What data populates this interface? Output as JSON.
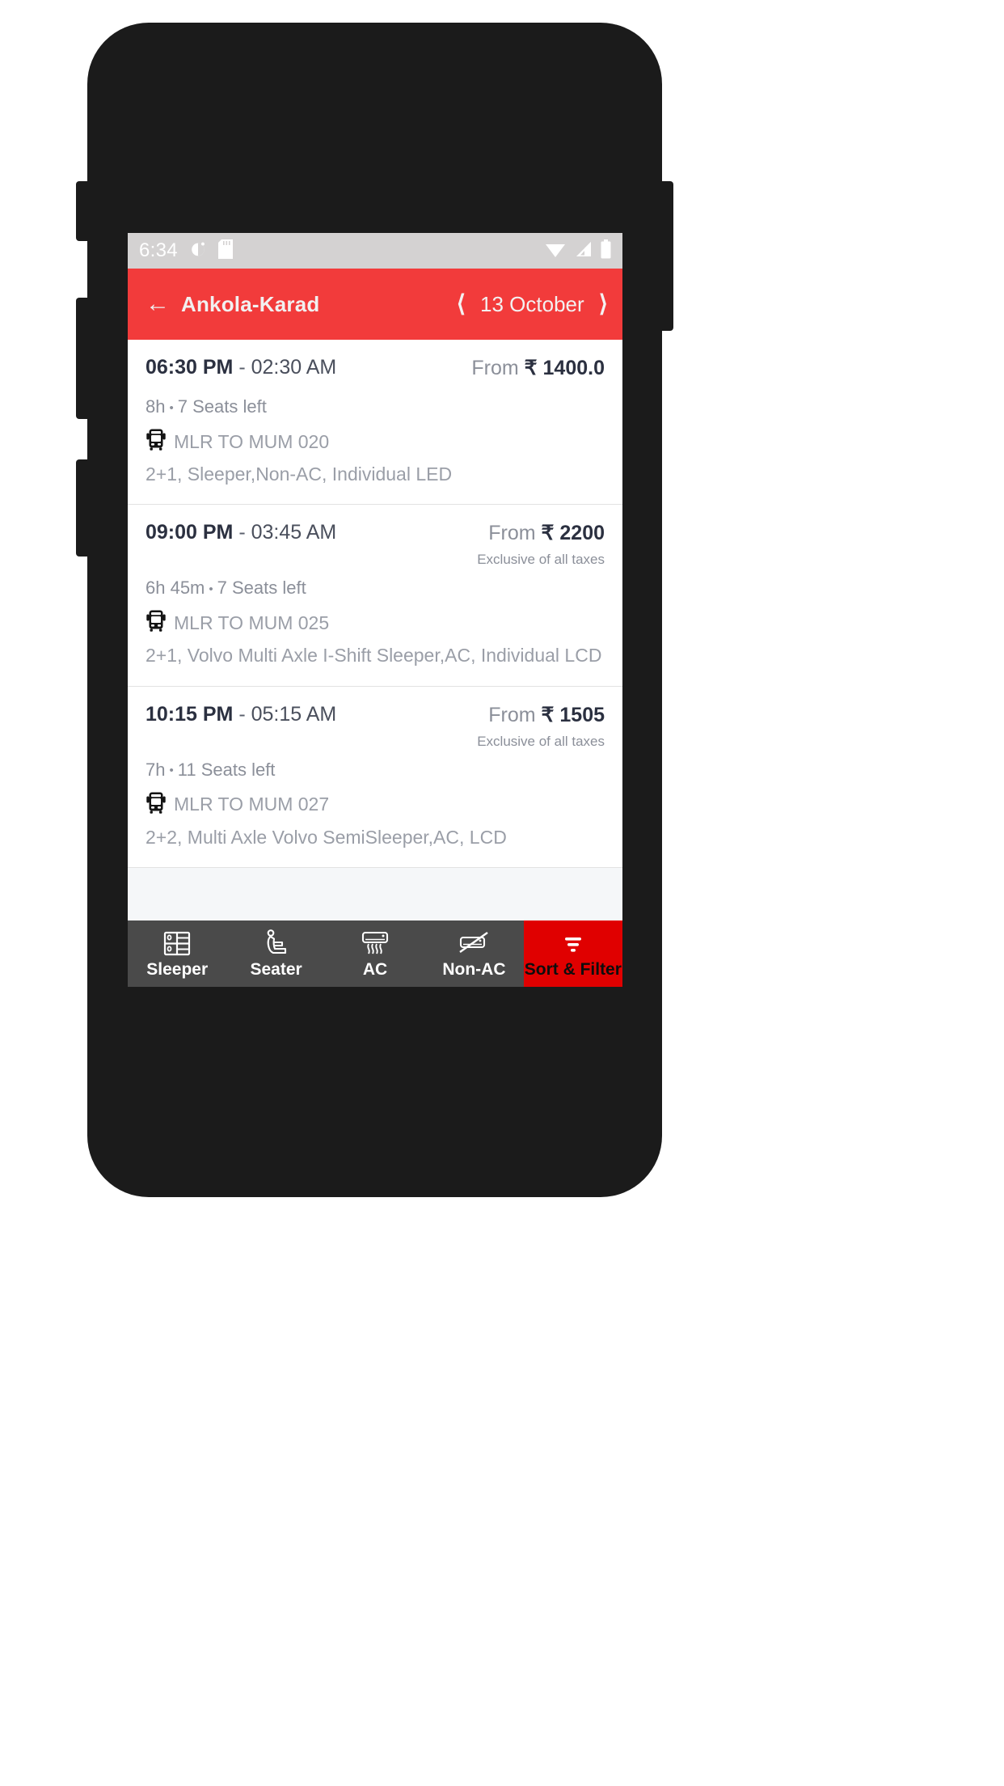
{
  "status_bar": {
    "time": "6:34",
    "left_icons": [
      "dnd-icon",
      "sd-card-icon"
    ],
    "right_icons": [
      "wifi-icon",
      "signal-icon",
      "battery-icon"
    ],
    "background": "#d4d2d2"
  },
  "app_bar": {
    "back_icon": "back-arrow-icon",
    "route_title": "Ankola-Karad",
    "prev_icon": "chevron-left-icon",
    "date": "13 October",
    "next_icon": "chevron-right-icon",
    "background": "#f23b3b"
  },
  "results": [
    {
      "departure": "06:30 PM",
      "separator": "-",
      "arrival": "02:30 AM",
      "price_from_label": "From",
      "price": "₹ 1400.0",
      "tax_note": "",
      "duration": "8h",
      "bullet": "•",
      "seats_left": "7 Seats left",
      "bus_icon": "bus-icon",
      "bus_name": "MLR TO MUM 020",
      "bus_description": "2+1, Sleeper,Non-AC, Individual LED"
    },
    {
      "departure": "09:00 PM",
      "separator": "-",
      "arrival": "03:45 AM",
      "price_from_label": "From",
      "price": "₹ 2200",
      "tax_note": "Exclusive of all taxes",
      "duration": "6h 45m",
      "bullet": "•",
      "seats_left": "7 Seats left",
      "bus_icon": "bus-icon",
      "bus_name": "MLR TO MUM 025",
      "bus_description": "2+1, Volvo Multi Axle I-Shift Sleeper,AC, Individual LCD"
    },
    {
      "departure": "10:15 PM",
      "separator": "-",
      "arrival": "05:15 AM",
      "price_from_label": "From",
      "price": "₹ 1505",
      "tax_note": "Exclusive of all taxes",
      "duration": "7h",
      "bullet": "•",
      "seats_left": "11 Seats left",
      "bus_icon": "bus-icon",
      "bus_name": "MLR TO MUM 027",
      "bus_description": "2+2, Multi Axle Volvo SemiSleeper,AC, LCD"
    }
  ],
  "filter_bar": {
    "background": "#4a4a4a",
    "items": [
      {
        "label": "Sleeper",
        "icon": "sleeper-berth-icon"
      },
      {
        "label": "Seater",
        "icon": "seat-icon"
      },
      {
        "label": "AC",
        "icon": "air-conditioner-icon"
      },
      {
        "label": "Non-AC",
        "icon": "air-conditioner-off-icon"
      },
      {
        "label": "Sort & Filter",
        "icon": "filter-icon",
        "accent": "#e00000"
      }
    ]
  },
  "nav_bar": {
    "back_icon": "android-back-icon",
    "home_icon": "android-home-icon",
    "recents_icon": "android-recents-icon"
  }
}
